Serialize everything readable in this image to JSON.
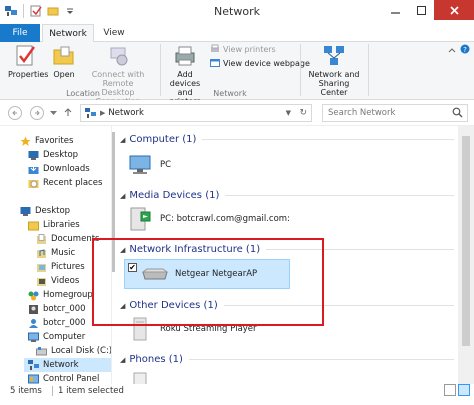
{
  "window": {
    "title": "Network"
  },
  "tabs": {
    "file": "File",
    "network": "Network",
    "view": "View"
  },
  "ribbon": {
    "properties": "Properties",
    "open": "Open",
    "connect_remote_line1": "Connect with Remote",
    "connect_remote_line2": "Desktop Connection",
    "add_devices_line1": "Add devices",
    "add_devices_line2": "and printers",
    "view_printers": "View printers",
    "view_device_webpage": "View device webpage",
    "network_sharing_line1": "Network and",
    "network_sharing_line2": "Sharing Center",
    "group_location": "Location",
    "group_network": "Network"
  },
  "address": {
    "path": "Network",
    "search_placeholder": "Search Network"
  },
  "navpane": {
    "items": [
      {
        "label": "Favorites"
      },
      {
        "label": "Desktop"
      },
      {
        "label": "Downloads"
      },
      {
        "label": "Recent places"
      },
      {
        "label": "Desktop"
      },
      {
        "label": "Libraries"
      },
      {
        "label": "Documents"
      },
      {
        "label": "Music"
      },
      {
        "label": "Pictures"
      },
      {
        "label": "Videos"
      },
      {
        "label": "Homegroup"
      },
      {
        "label": "botcr_000"
      },
      {
        "label": "botcr_000"
      },
      {
        "label": "Computer"
      },
      {
        "label": "Local Disk (C:)"
      },
      {
        "label": "Network"
      },
      {
        "label": "Control Panel"
      }
    ]
  },
  "content": {
    "groups": [
      {
        "title": "Computer (1)"
      },
      {
        "title": "Media Devices (1)"
      },
      {
        "title": "Network Infrastructure (1)"
      },
      {
        "title": "Other Devices (1)"
      },
      {
        "title": "Phones (1)"
      }
    ],
    "items": [
      {
        "label": "PC"
      },
      {
        "label": "PC: botcrawl.com@gmail.com:"
      },
      {
        "label": "Netgear NetgearAP",
        "checked": "✔"
      },
      {
        "label": "Roku Streaming Player"
      }
    ]
  },
  "status": {
    "items": "5 items",
    "selected": "1 item selected"
  },
  "colors": {
    "accent": "#1979ca",
    "highlight": "#d91a22",
    "selection": "#cce8ff"
  }
}
